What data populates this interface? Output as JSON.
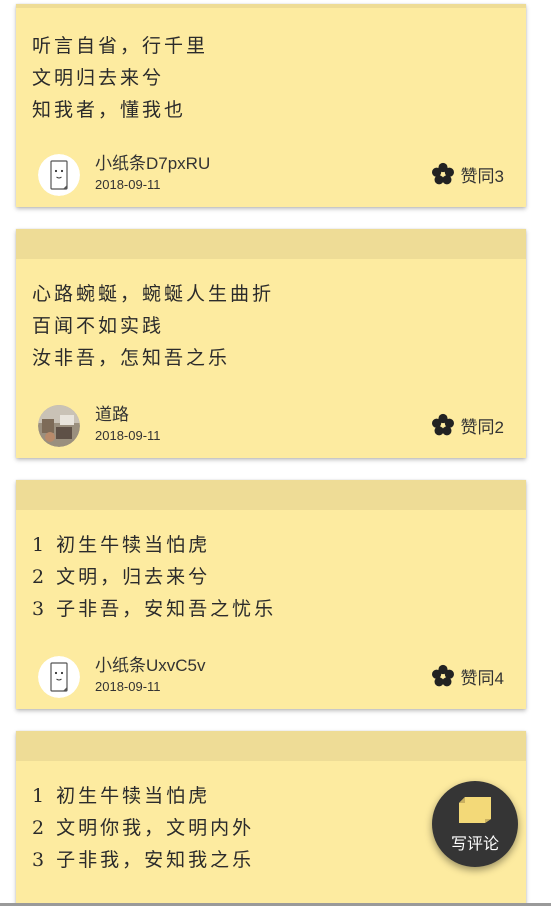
{
  "colors": {
    "card_background": "#fdeba0",
    "card_strip": "#eedc96",
    "fab_background": "#353535",
    "fab_icon": "#f3d978"
  },
  "cards": [
    {
      "lines": [
        "听言自省，行千里",
        "文明归去来兮",
        "知我者，懂我也"
      ],
      "author": "小纸条D7pxRU",
      "date": "2018-09-11",
      "avatar_icon": "paper-note-face-icon",
      "like_label": "赞同3"
    },
    {
      "lines": [
        "心路蜿蜒，蜿蜒人生曲折",
        "百闻不如实践",
        "汝非吾，怎知吾之乐"
      ],
      "author": "道路",
      "date": "2018-09-11",
      "avatar_icon": "photo-avatar",
      "like_label": "赞同2"
    },
    {
      "lines": [
        "1 初生牛犊当怕虎",
        "2 文明，归去来兮",
        "3 子非吾，安知吾之忧乐"
      ],
      "author": "小纸条UxvC5v",
      "date": "2018-09-11",
      "avatar_icon": "paper-note-face-icon",
      "like_label": "赞同4"
    },
    {
      "lines": [
        "1 初生牛犊当怕虎",
        "2 文明你我，文明内外",
        "3 子非我，安知我之乐"
      ]
    }
  ],
  "like_icon": "flower-icon",
  "fab": {
    "label": "写评论",
    "icon": "sticky-note-icon"
  }
}
